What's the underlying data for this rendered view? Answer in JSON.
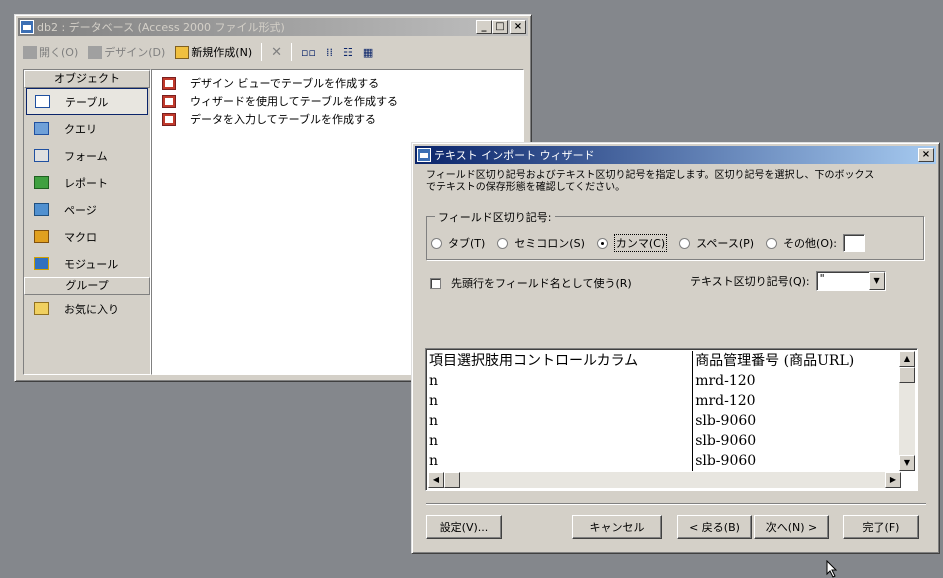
{
  "db_window": {
    "title": "db2 : データベース (Access 2000 ファイル形式)",
    "toolbar": {
      "open": "開く(O)",
      "design": "デザイン(D)",
      "new": "新規作成(N)"
    },
    "objects_header": "オブジェクト",
    "objects": [
      {
        "label": "テーブル"
      },
      {
        "label": "クエリ"
      },
      {
        "label": "フォーム"
      },
      {
        "label": "レポート"
      },
      {
        "label": "ページ"
      },
      {
        "label": "マクロ"
      },
      {
        "label": "モジュール"
      }
    ],
    "groups_header": "グループ",
    "favorites": "お気に入り",
    "list": [
      "デザイン ビューでテーブルを作成する",
      "ウィザードを使用してテーブルを作成する",
      "データを入力してテーブルを作成する"
    ]
  },
  "wizard": {
    "title": "テキスト インポート ウィザード",
    "description_1": "フィールド区切り記号およびテキスト区切り記号を指定します。区切り記号を選択し、下のボックス",
    "description_2": "でテキストの保存形態を確認してください。",
    "delimiter_group": "フィールド区切り記号:",
    "delimiters": {
      "tab": "タブ(T)",
      "semicolon": "セミコロン(S)",
      "comma": "カンマ(C)",
      "space": "スペース(P)",
      "other": "その他(O):"
    },
    "selected_delimiter": "comma",
    "first_row_label": "先頭行をフィールド名として使う(R)",
    "text_qualifier_label": "テキスト区切り記号(Q):",
    "text_qualifier_value": "\"",
    "preview_rows": [
      [
        "項目選択肢用コントロールカラム",
        "商品管理番号 (商品URL)"
      ],
      [
        "n",
        "mrd-120"
      ],
      [
        "n",
        "mrd-120"
      ],
      [
        "n",
        "slb-9060"
      ],
      [
        "n",
        "slb-9060"
      ],
      [
        "n",
        "slb-9060"
      ]
    ],
    "buttons": {
      "settings": "設定(V)...",
      "cancel": "キャンセル",
      "back": "< 戻る(B)",
      "next": "次へ(N) >",
      "finish": "完了(F)"
    }
  },
  "colors": {
    "desktop": "#84878c",
    "face": "#d4d0c8",
    "active_title": "#0a246a"
  }
}
